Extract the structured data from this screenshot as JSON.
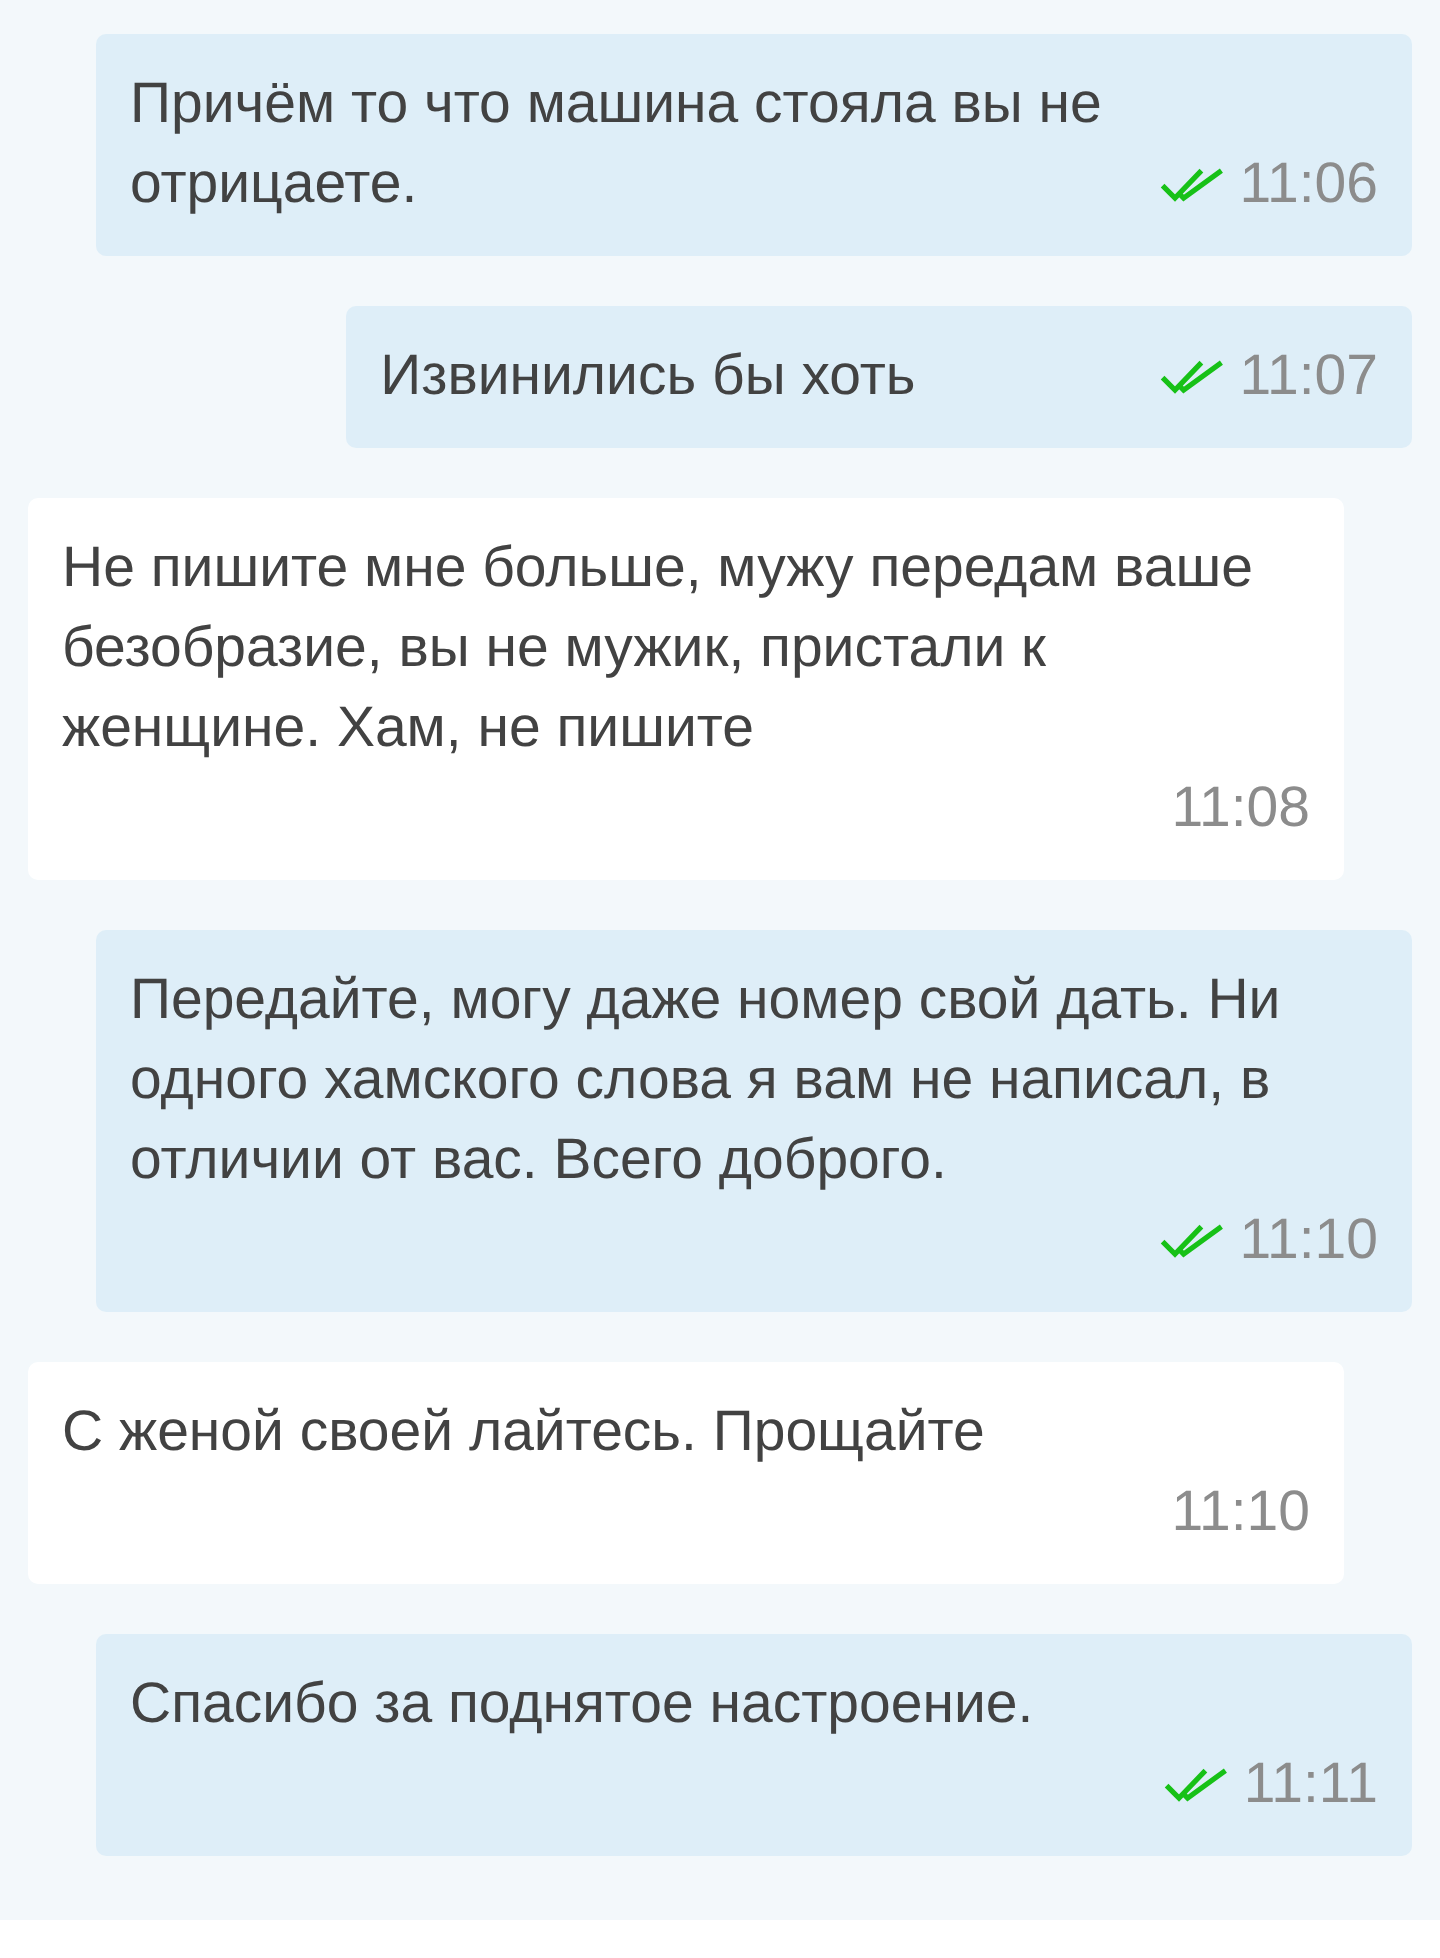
{
  "messages": [
    {
      "kind": "outgoing",
      "text": "Причём то что машина стояла вы не отрицаете.",
      "time": "11:06",
      "read": true
    },
    {
      "kind": "outgoing",
      "text": "Извинились бы хоть",
      "time": "11:07",
      "read": true
    },
    {
      "kind": "incoming",
      "text": "Не пишите мне больше, мужу передам ваше безобразие, вы не мужик, пристали к женщине. Хам, не пишите",
      "time": "11:08"
    },
    {
      "kind": "outgoing",
      "text": "Передайте, могу даже номер свой дать. Ни одного хамского слова я вам не написал, в отличии от вас. Всего доброго.",
      "time": "11:10",
      "read": true
    },
    {
      "kind": "incoming",
      "text": "С женой своей лайтесь. Прощайте",
      "time": "11:10"
    },
    {
      "kind": "outgoing",
      "text": "Спасибо за поднятое настроение.",
      "time": "11:11",
      "read": true
    }
  ]
}
